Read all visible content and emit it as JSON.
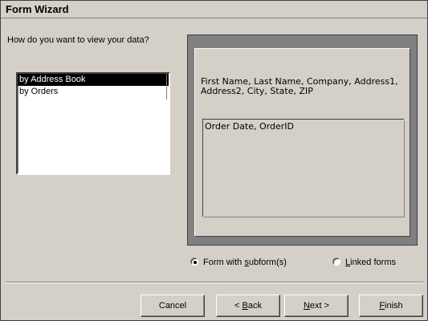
{
  "window": {
    "title": "Form Wizard"
  },
  "question": {
    "prompt": "How do you want to view your data?"
  },
  "view_options": [
    {
      "label": "by Address Book",
      "selected": true
    },
    {
      "label": "by Orders",
      "selected": false
    }
  ],
  "preview": {
    "main_fields": "First Name, Last Name, Company, Address1, Address2, City, State, ZIP",
    "subform_fields": "Order Date, OrderID"
  },
  "form_type": {
    "options": [
      {
        "label_before": "Form with ",
        "label_key": "s",
        "label_after": "ubform(s)",
        "selected": true
      },
      {
        "label_before": "",
        "label_key": "L",
        "label_after": "inked forms",
        "selected": false
      }
    ]
  },
  "buttons": {
    "cancel": {
      "label_before": "Cancel",
      "label_key": "",
      "label_after": ""
    },
    "back": {
      "label_before": "< ",
      "label_key": "B",
      "label_after": "ack"
    },
    "next": {
      "label_before": "",
      "label_key": "N",
      "label_after": "ext >"
    },
    "finish": {
      "label_before": "",
      "label_key": "F",
      "label_after": "inish"
    }
  },
  "colors": {
    "face": "#d4d0c8",
    "preview_frame": "#808080",
    "selection": "#000000"
  }
}
